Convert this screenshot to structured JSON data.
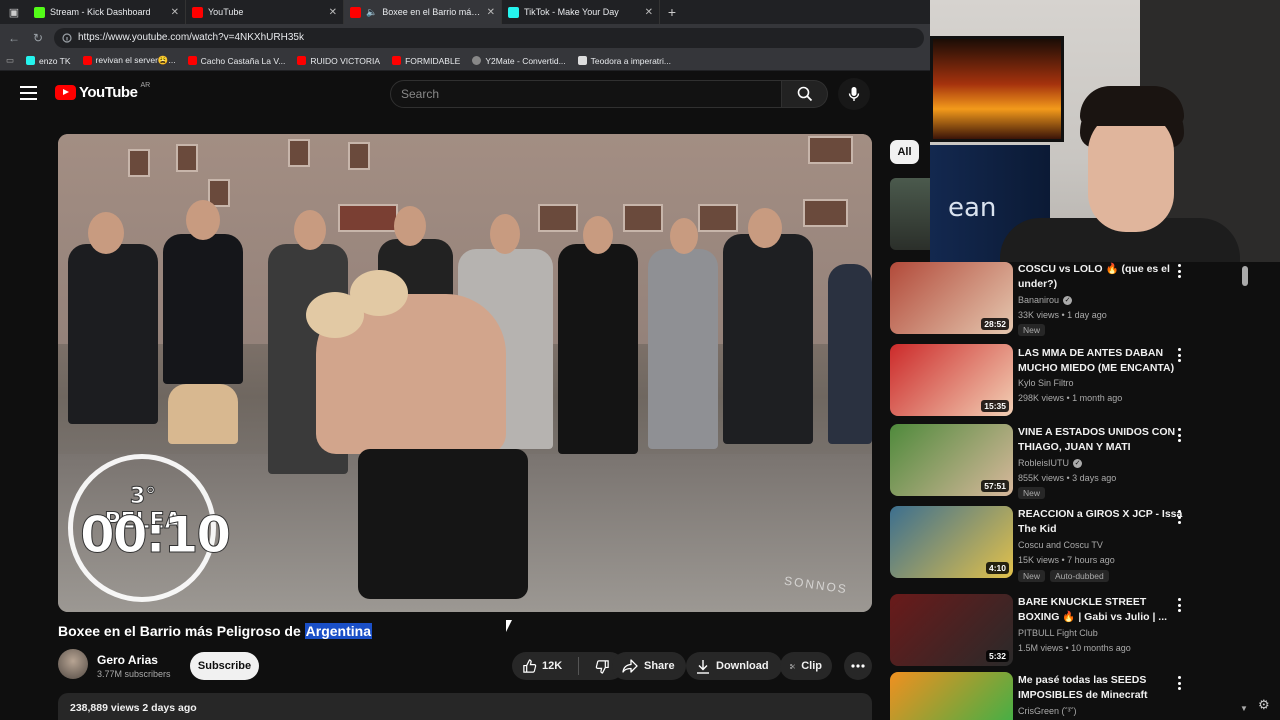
{
  "browser": {
    "tabs": [
      {
        "title": "Stream - Kick Dashboard",
        "color": "#53fc18",
        "active": false
      },
      {
        "title": "YouTube",
        "color": "#ff0000",
        "active": false
      },
      {
        "title": "Boxee en el Barrio más Pelig",
        "color": "#ff0000",
        "active": true
      },
      {
        "title": "TikTok - Make Your Day",
        "color": "#25f4ee",
        "active": false
      }
    ],
    "close_glyph": "✕",
    "new_tab_glyph": "+",
    "url": "https://www.youtube.com/watch?v=4NKXhURH35k",
    "bookmarks": [
      {
        "label": "enzo TK",
        "color": "#25f4ee"
      },
      {
        "label": "revivan el server😩...",
        "color": "#ff0000"
      },
      {
        "label": "Cacho Castaña La V...",
        "color": "#ff0000"
      },
      {
        "label": "RUIDO VICTORIA",
        "color": "#ff0000"
      },
      {
        "label": "FORMIDABLE",
        "color": "#ff0000"
      },
      {
        "label": "Y2Mate - Convertid...",
        "color": "#888888"
      },
      {
        "label": "Teodora a imperatri...",
        "color": "#dddddd"
      }
    ]
  },
  "youtube": {
    "logo_text": "YouTube",
    "country": "AR",
    "search_placeholder": "Search"
  },
  "video": {
    "overlay_label": "3° PELEA",
    "overlay_timer": "00:10",
    "watermark": "SONNOS",
    "title_prefix": "Boxee en el Barrio más Peligroso de ",
    "title_highlight": "Argentina",
    "channel_name": "Gero Arias",
    "subscribers": "3.77M subscribers",
    "subscribe_label": "Subscribe",
    "likes": "12K",
    "share_label": "Share",
    "download_label": "Download",
    "clip_label": "Clip",
    "views_date": "238,889 views  2 days ago"
  },
  "sidebar": {
    "chip_all": "All",
    "cam_shirt_text": "ean",
    "items": [
      {
        "title": "COSCU vs LOLO 🔥 (que es el under?)",
        "channel": "Bananirou",
        "verified": true,
        "meta": "33K views • 1 day ago",
        "badge": "New",
        "badge2": "",
        "duration": "28:52",
        "colors": [
          "#b24a3a",
          "#e5c8b0"
        ]
      },
      {
        "title": "LAS MMA DE ANTES DABAN MUCHO MIEDO (ME ENCANTA)",
        "channel": "Kylo Sin Filtro",
        "verified": false,
        "meta": "298K views • 1 month ago",
        "badge": "",
        "badge2": "",
        "duration": "15:35",
        "colors": [
          "#cc2a2a",
          "#f2d0b5"
        ]
      },
      {
        "title": "VINE A ESTADOS UNIDOS CON THIAGO, JUAN Y MATI",
        "channel": "RobleisIUTU",
        "verified": true,
        "meta": "855K views • 3 days ago",
        "badge": "New",
        "badge2": "",
        "duration": "57:51",
        "colors": [
          "#4f8a3c",
          "#d8b89c"
        ]
      },
      {
        "title": "REACCION a GIROS X JCP - Issa The Kid",
        "channel": "Coscu  and Coscu TV",
        "verified": true,
        "meta": "15K views • 7 hours ago",
        "badge": "New",
        "badge2": "Auto-dubbed",
        "duration": "4:10",
        "colors": [
          "#3c6f8f",
          "#e2c14b"
        ]
      },
      {
        "title": "BARE KNUCKLE STREET BOXING 🔥 | Gabi vs Julio | ...",
        "channel": "PITBULL Fight Club",
        "verified": false,
        "meta": "1.5M views • 10 months ago",
        "badge": "",
        "badge2": "",
        "duration": "5:32",
        "colors": [
          "#6a1a1a",
          "#2a2a2a"
        ]
      },
      {
        "title": "Me pasé todas las SEEDS IMPOSIBLES de Minecraft",
        "channel": "CrisGreen (˘³˘)",
        "verified": false,
        "meta": "",
        "badge": "",
        "badge2": "",
        "duration": "",
        "colors": [
          "#f09020",
          "#2fb34a"
        ]
      }
    ]
  }
}
